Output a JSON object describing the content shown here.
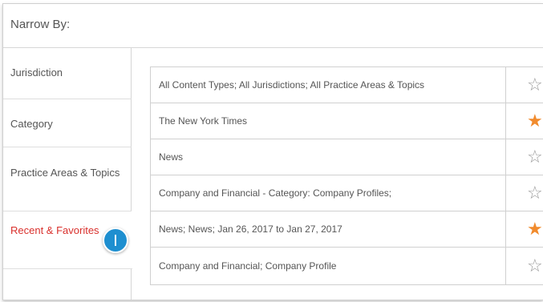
{
  "narrow_by": {
    "title": "Narrow By:"
  },
  "sidebar": {
    "items": [
      {
        "label": "Jurisdiction"
      },
      {
        "label": "Category"
      },
      {
        "label": "Practice Areas & Topics"
      },
      {
        "label": "Recent & Favorites",
        "selected": true
      }
    ]
  },
  "callout": {
    "label": "1"
  },
  "results": {
    "rows": [
      {
        "label": "All Content Types; All Jurisdictions; All Practice Areas & Topics",
        "favorite": false,
        "star": "☆"
      },
      {
        "label": "The New York Times",
        "favorite": true,
        "star": "★"
      },
      {
        "label": "News",
        "favorite": false,
        "star": "☆"
      },
      {
        "label": "Company and Financial - Category: Company Profiles;",
        "favorite": false,
        "star": "☆"
      },
      {
        "label": "News; News; Jan 26, 2017 to Jan 27, 2017",
        "favorite": true,
        "star": "★"
      },
      {
        "label": "Company and Financial; Company Profile",
        "favorite": false,
        "star": "☆"
      }
    ]
  },
  "colors": {
    "selected_text": "#d9302c",
    "favorite_star": "#f18b2d",
    "empty_star": "#9a9a9a",
    "callout_badge": "#1e8fd0"
  },
  "icons": {
    "favorite": "star-filled-icon",
    "not_favorite": "star-outline-icon",
    "callout": "step-number-badge"
  }
}
